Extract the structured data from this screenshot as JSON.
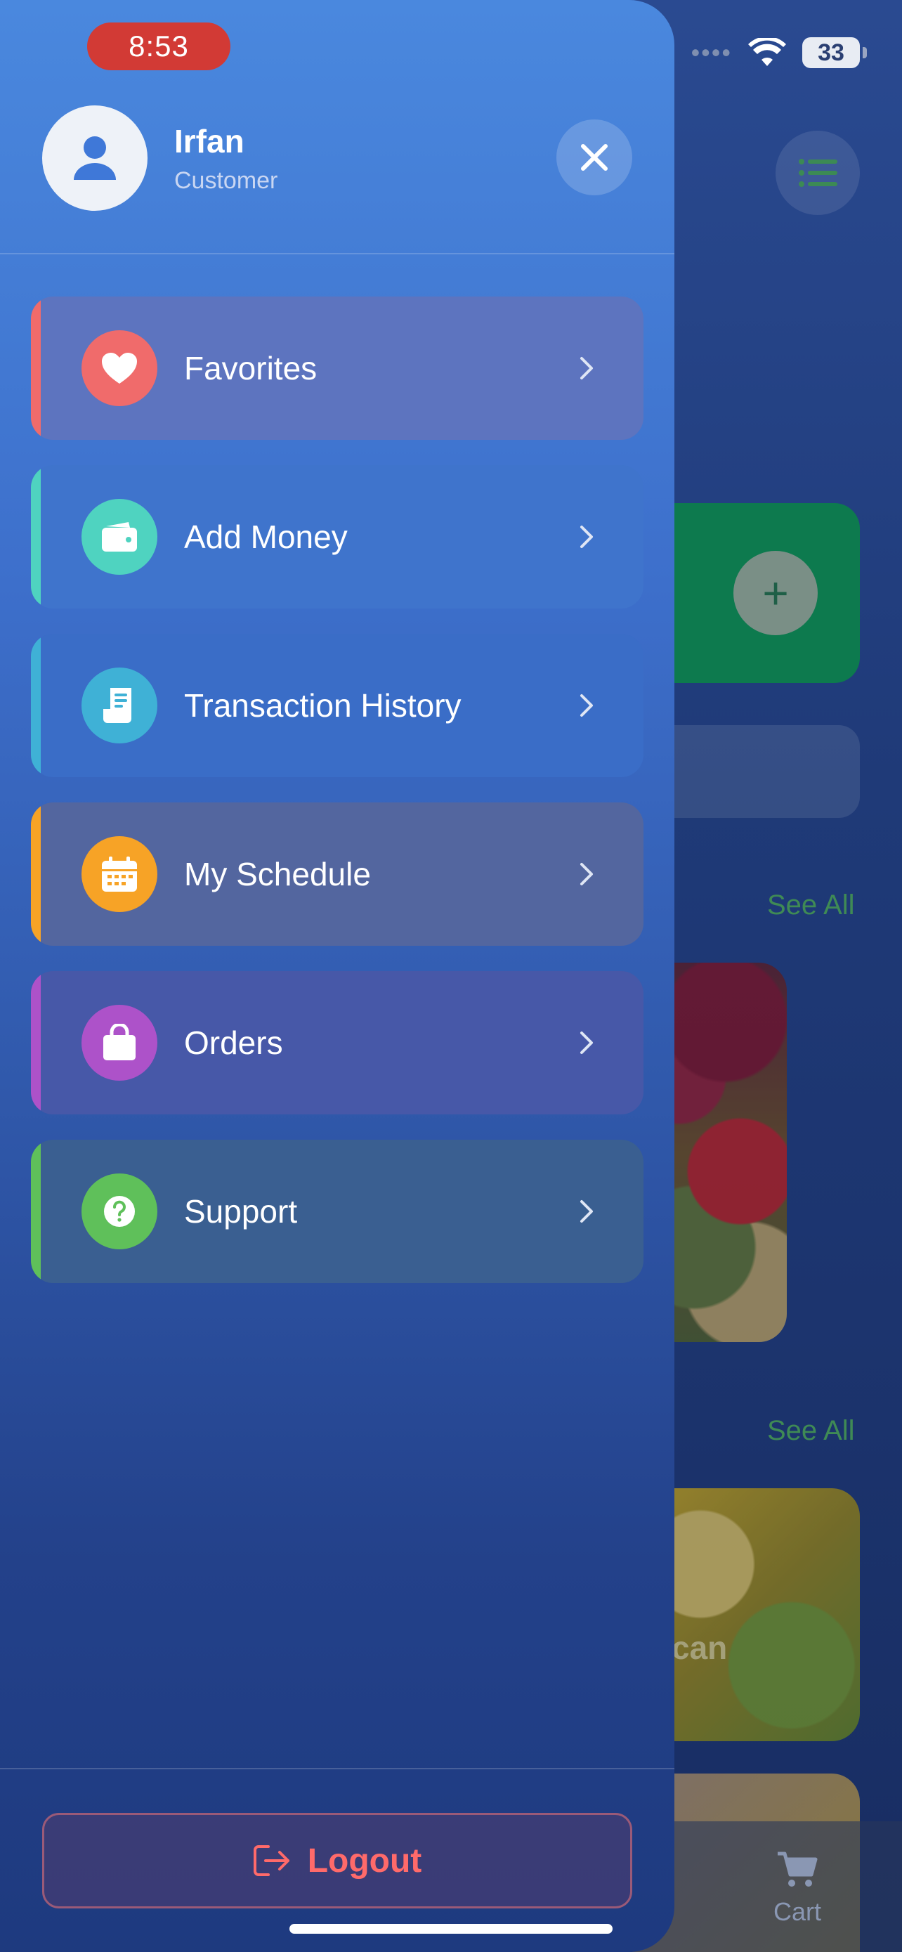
{
  "status_bar": {
    "time": "8:53",
    "battery": "33"
  },
  "profile": {
    "name": "Irfan",
    "role": "Customer"
  },
  "menu": {
    "items": [
      {
        "label": "Favorites",
        "icon": "heart-icon",
        "accent": "#f06b6b",
        "tint": "#5d74bf"
      },
      {
        "label": "Add Money",
        "icon": "wallet-icon",
        "accent": "#4fd3c0",
        "tint": "#3f74cc"
      },
      {
        "label": "Transaction History",
        "icon": "receipt-icon",
        "accent": "#3fb1d6",
        "tint": "#3a6dc7"
      },
      {
        "label": "My Schedule",
        "icon": "calendar-icon",
        "accent": "#f7a326",
        "tint": "#53669f"
      },
      {
        "label": "Orders",
        "icon": "shopping-bag-icon",
        "accent": "#ad52c9",
        "tint": "#4758a8"
      },
      {
        "label": "Support",
        "icon": "help-circle-icon",
        "accent": "#5fc05a",
        "tint": "#3a5f91"
      }
    ]
  },
  "logout": {
    "label": "Logout",
    "color": "#ff6a6a"
  },
  "background": {
    "see_all_1": "See All",
    "see_all_2": "See All",
    "card_label": "can",
    "cart_label": "Cart"
  }
}
